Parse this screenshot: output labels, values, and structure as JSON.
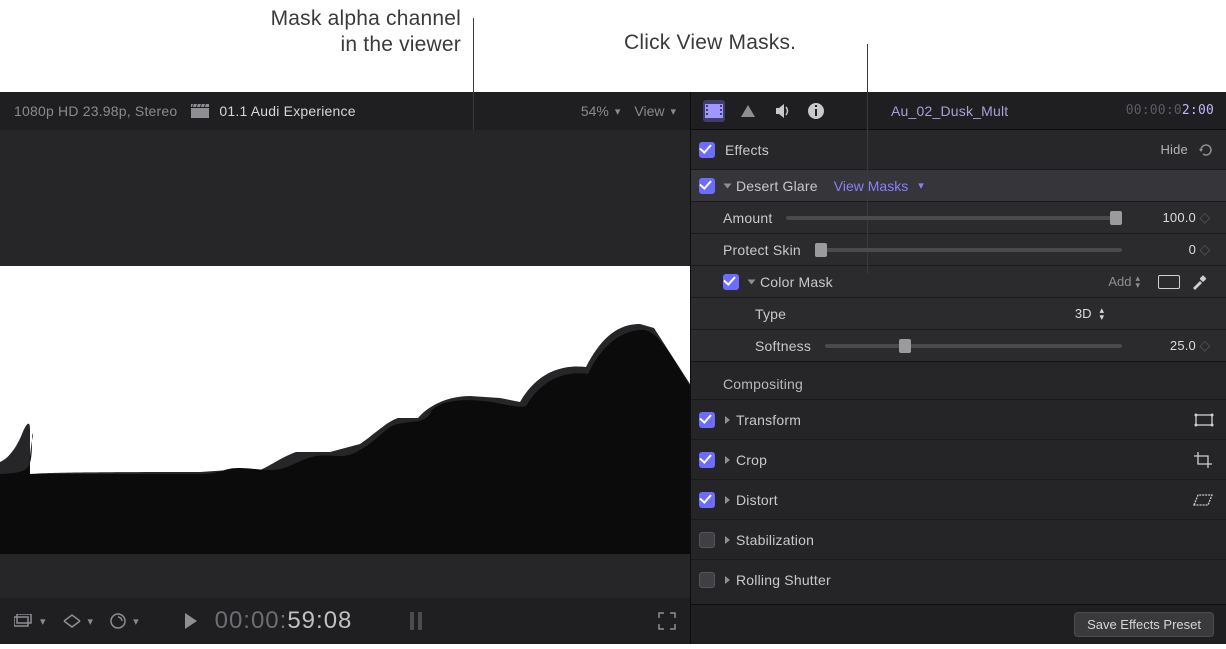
{
  "annotations": {
    "left": "Mask alpha channel\nin the viewer",
    "right": "Click View Masks."
  },
  "viewer": {
    "format": "1080p HD 23.98p, Stereo",
    "clip_title": "01.1 Audi Experience",
    "zoom": "54%",
    "view_menu": "View",
    "timecode_prefix": "00:00:",
    "timecode_main": "59:08"
  },
  "inspector": {
    "clip_name": "Au_02_Dusk_Mult",
    "clip_tc_dim": "00:00:0",
    "clip_tc_lit": "2:00",
    "effects_header": "Effects",
    "hide_label": "Hide",
    "effect": {
      "name": "Desert Glare",
      "view_masks": "View Masks",
      "params": {
        "amount": {
          "label": "Amount",
          "value": "100.0"
        },
        "protect_skin": {
          "label": "Protect Skin",
          "value": "0"
        },
        "color_mask": {
          "label": "Color Mask",
          "add": "Add",
          "type_label": "Type",
          "type_value": "3D",
          "softness_label": "Softness",
          "softness_value": "25.0"
        }
      }
    },
    "sections": {
      "compositing": "Compositing",
      "transform": "Transform",
      "crop": "Crop",
      "distort": "Distort",
      "stabilization": "Stabilization",
      "rolling_shutter": "Rolling Shutter"
    },
    "save_preset": "Save Effects Preset"
  },
  "icons": {
    "clapper": "clapper-icon",
    "video_tab": "video-tab-icon",
    "color_tab": "color-tab-icon",
    "audio_tab": "audio-tab-icon",
    "info_tab": "info-tab-icon",
    "reset": "reset-icon",
    "transform": "transform-icon",
    "crop": "crop-icon",
    "distort": "distort-icon",
    "fullscreen": "fullscreen-icon",
    "play": "play-icon"
  }
}
